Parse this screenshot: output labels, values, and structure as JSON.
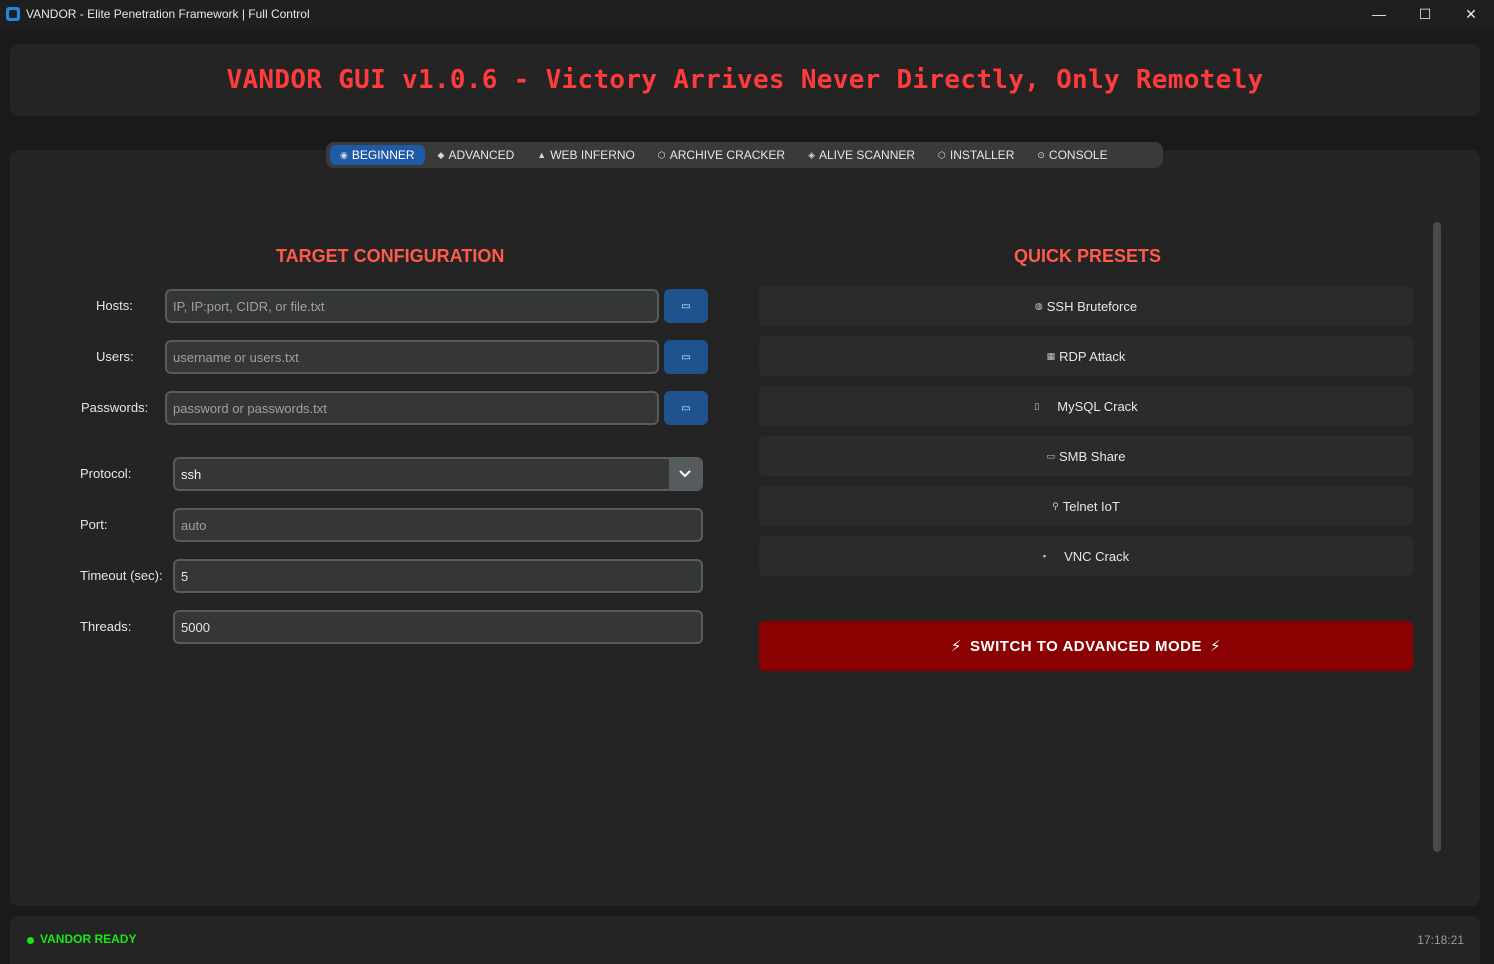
{
  "window": {
    "title": "VANDOR - Elite Penetration Framework | Full Control",
    "minimize": "—",
    "maximize": "☐",
    "close": "✕"
  },
  "header": {
    "title": "VANDOR GUI v1.0.6 - Victory Arrives Never Directly, Only Remotely"
  },
  "tabs": [
    {
      "label": "BEGINNER",
      "icon": "◉",
      "active": true
    },
    {
      "label": "ADVANCED",
      "icon": "◆",
      "active": false
    },
    {
      "label": "WEB INFERNO",
      "icon": "▲",
      "active": false
    },
    {
      "label": "ARCHIVE CRACKER",
      "icon": "⬡",
      "active": false
    },
    {
      "label": "ALIVE SCANNER",
      "icon": "◈",
      "active": false
    },
    {
      "label": "INSTALLER",
      "icon": "⬡",
      "active": false
    },
    {
      "label": "CONSOLE",
      "icon": "⊙",
      "active": false
    }
  ],
  "target": {
    "title": "TARGET CONFIGURATION",
    "hosts_label": "Hosts:",
    "hosts_placeholder": "IP, IP:port, CIDR, or file.txt",
    "users_label": "Users:",
    "users_placeholder": "username or users.txt",
    "passwords_label": "Passwords:",
    "passwords_placeholder": "password or passwords.txt",
    "browse_icon": "▭",
    "protocol_label": "Protocol:",
    "protocol_value": "ssh",
    "port_label": "Port:",
    "port_placeholder": "auto",
    "timeout_label": "Timeout (sec):",
    "timeout_value": "5",
    "threads_label": "Threads:",
    "threads_value": "5000"
  },
  "presets": {
    "title": "QUICK PRESETS",
    "items": [
      {
        "label": "SSH Bruteforce",
        "icon": "◍"
      },
      {
        "label": "RDP Attack",
        "icon": "▦"
      },
      {
        "label": "MySQL Crack",
        "icon": "▯"
      },
      {
        "label": "SMB Share",
        "icon": "▭"
      },
      {
        "label": "Telnet IoT",
        "icon": "⚲"
      },
      {
        "label": "VNC Crack",
        "icon": "▪"
      }
    ],
    "advanced_label": "SWITCH TO ADVANCED MODE",
    "bolt": "⚡"
  },
  "status": {
    "text": "VANDOR READY",
    "time": "17:18:21"
  }
}
